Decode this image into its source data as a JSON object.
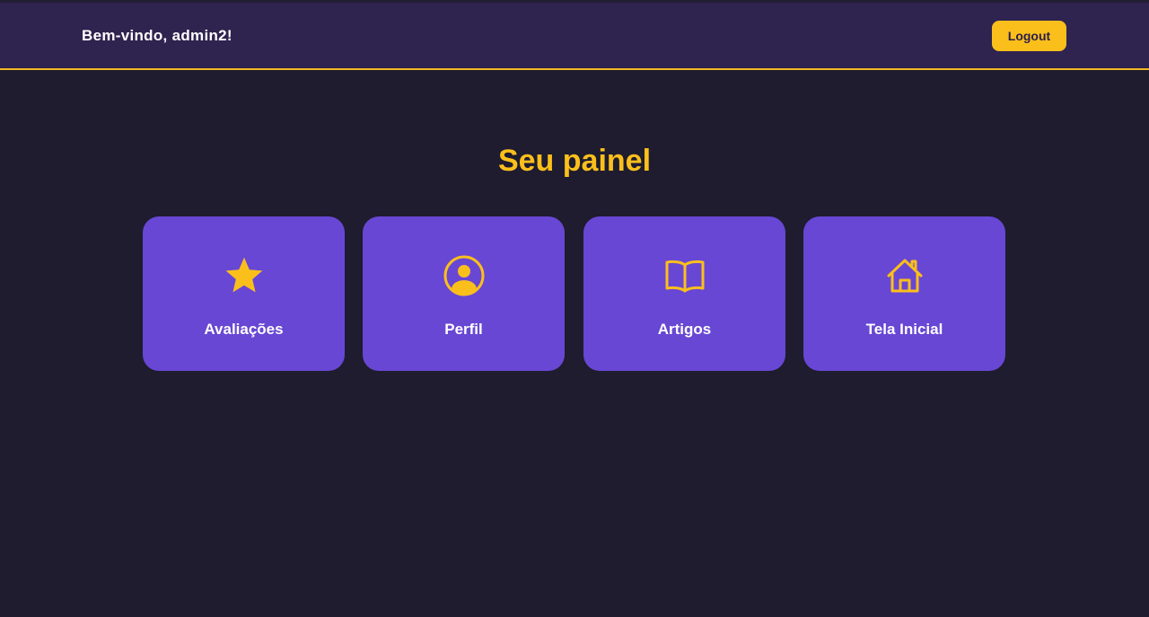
{
  "header": {
    "welcome": "Bem-vindo, admin2!",
    "logout_label": "Logout"
  },
  "main": {
    "title": "Seu painel",
    "cards": [
      {
        "label": "Avaliações",
        "icon": "star-icon"
      },
      {
        "label": "Perfil",
        "icon": "user-circle-icon"
      },
      {
        "label": "Artigos",
        "icon": "book-open-icon"
      },
      {
        "label": "Tela Inicial",
        "icon": "home-icon"
      }
    ]
  },
  "colors": {
    "accent": "#fbbf1c",
    "card": "#6847d4",
    "header": "#2f234f",
    "background": "#1e1c2e"
  }
}
